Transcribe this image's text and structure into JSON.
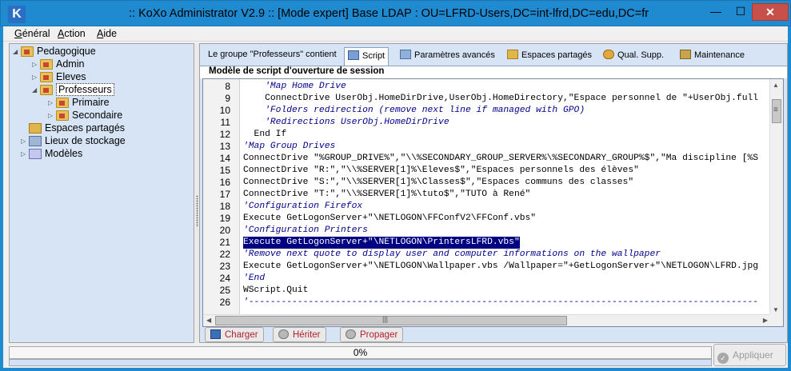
{
  "window": {
    "title": ":: KoXo Administrator V2.9 :: [Mode expert] Base LDAP : OU=LFRD-Users,DC=int-lfrd,DC=edu,DC=fr",
    "icon_letter": "K",
    "minimize": "—",
    "maximize": "☐",
    "close": "✕"
  },
  "menu": {
    "items": [
      {
        "first": "G",
        "rest": "énéral"
      },
      {
        "first": "A",
        "rest": "ction"
      },
      {
        "first": "A",
        "rest": "ide"
      }
    ]
  },
  "tree": {
    "nodes": [
      {
        "label": "Pedagogique",
        "icon": "folder-icon",
        "state": "expanded"
      },
      {
        "label": "Admin",
        "icon": "folder-icon",
        "state": "collapsed"
      },
      {
        "label": "Eleves",
        "icon": "folder-icon",
        "state": "collapsed"
      },
      {
        "label": "Professeurs",
        "icon": "folder-icon",
        "state": "expanded",
        "selected": true
      },
      {
        "label": "Primaire",
        "icon": "folder-icon",
        "state": "collapsed"
      },
      {
        "label": "Secondaire",
        "icon": "folder-icon",
        "state": "collapsed"
      },
      {
        "label": "Espaces partagés",
        "icon": "share-icon",
        "state": "none"
      },
      {
        "label": "Lieux de stockage",
        "icon": "storage-icon",
        "state": "collapsed"
      },
      {
        "label": "Modèles",
        "icon": "model-icon",
        "state": "collapsed"
      }
    ]
  },
  "tabs": [
    {
      "label": "Le groupe \"Professeurs\" contient",
      "active": false
    },
    {
      "label": "Script",
      "active": true
    },
    {
      "label": "Paramètres avancés",
      "active": false
    },
    {
      "label": "Espaces partagés",
      "active": false
    },
    {
      "label": "Qual. Supp.",
      "active": false
    },
    {
      "label": "Maintenance",
      "active": false
    }
  ],
  "section_title": "Modèle de script d'ouverture de session",
  "editor": {
    "lines": [
      {
        "n": "8",
        "text": "    'Map Home Drive"
      },
      {
        "n": "9",
        "text": "    ConnectDrive UserObj.HomeDirDrive,UserObj.HomeDirectory,\"Espace personnel de \"+UserObj.full"
      },
      {
        "n": "10",
        "text": "    'Folders redirection (remove next line if managed with GPO)"
      },
      {
        "n": "11",
        "text": "    'Redirections UserObj.HomeDirDrive"
      },
      {
        "n": "12",
        "text": "  End If"
      },
      {
        "n": "13",
        "text": "'Map Group Drives"
      },
      {
        "n": "14",
        "text": "ConnectDrive \"%GROUP_DRIVE%\",\"\\\\%SECONDARY_GROUP_SERVER%\\%SECONDARY_GROUP%$\",\"Ma discipline [%S"
      },
      {
        "n": "15",
        "text": "ConnectDrive \"R:\",\"\\\\%SERVER[1]%\\Eleves$\",\"Espaces personnels des élèves\""
      },
      {
        "n": "16",
        "text": "ConnectDrive \"S:\",\"\\\\%SERVER[1]%\\Classes$\",\"Espaces communs des classes\""
      },
      {
        "n": "17",
        "text": "ConnectDrive \"T:\",\"\\\\%SERVER[1]%\\tuto$\",\"TUTO à René\""
      },
      {
        "n": "18",
        "text": "'Configuration Firefox"
      },
      {
        "n": "19",
        "text": "Execute GetLogonServer+\"\\NETLOGON\\FFConfV2\\FFConf.vbs\""
      },
      {
        "n": "20",
        "text": "'Configuration Printers"
      },
      {
        "n": "21",
        "text": "Execute GetLogonServer+\"\\NETLOGON\\PrintersLFRD.vbs\"",
        "selected": true
      },
      {
        "n": "22",
        "text": "'Remove next quote to display user and computer informations on the wallpaper"
      },
      {
        "n": "23",
        "text": "Execute GetLogonServer+\"\\NETLOGON\\Wallpaper.vbs /Wallpaper=\"+GetLogonServer+\"\\NETLOGON\\LFRD.jpg"
      },
      {
        "n": "24",
        "text": "'End"
      },
      {
        "n": "25",
        "text": "WScript.Quit"
      },
      {
        "n": "26",
        "text": "'----------------------------------------------------------------------------------------------"
      }
    ]
  },
  "buttons": {
    "charger": "Charger",
    "heriter": "Hériter",
    "propager": "Propager",
    "appliquer": "Appliquer"
  },
  "progress": {
    "label": "0%",
    "value": 0
  },
  "colors": {
    "titlebar": "#1f8ad0",
    "panel": "#d6e4f5",
    "selection": "#000080",
    "button_text": "#b21f2f"
  }
}
